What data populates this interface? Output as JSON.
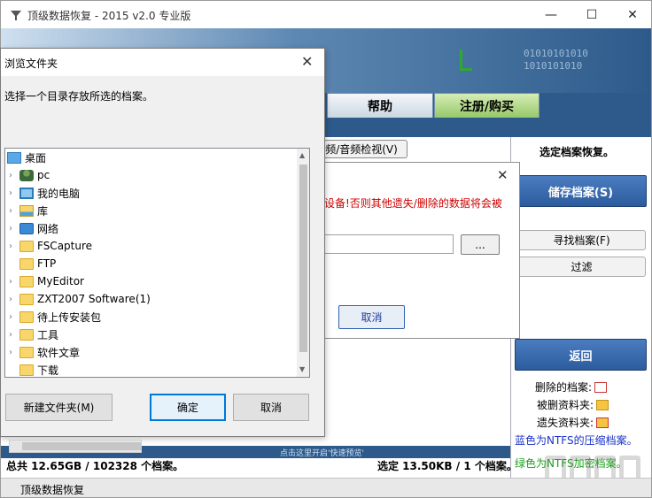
{
  "main_window": {
    "title": "顶级数据恢复 - 2015 v2.0 专业版",
    "controls": {
      "minimize": "—",
      "maximize": "☐",
      "close": "✕"
    }
  },
  "header": {
    "binary_text": "01010101010\n1010101010"
  },
  "tabs": [
    {
      "label": "帮助"
    },
    {
      "label": "注册/购买"
    }
  ],
  "preview_button": "频/音频检视(V)",
  "right_panel": {
    "title": "选定档案恢复。",
    "save_button": "储存档案(S)",
    "find_button": "寻找档案(F)",
    "filter_button": "过滤",
    "return_button": "返回",
    "legend": {
      "deleted": "删除的档案:",
      "deleted_folder": "被删资料夹:",
      "lost_folder": "遗失资料夹:",
      "blue_note": "蓝色为NTFS的压缩档案。",
      "green_note": "绿色为NTFS加密档案。"
    }
  },
  "mid_dialog": {
    "warning": "设备!否则其他遗失/删除的数据将会被",
    "browse_label": "...",
    "cancel_label": "取消"
  },
  "quickview_bar": "点击这里开启'快速预览'",
  "totals": {
    "left": "总共 12.65GB / 102328 个档案。",
    "right": "选定 13.50KB / 1 个档案。"
  },
  "taskbar": {
    "item": "顶级数据恢复"
  },
  "browse_dialog": {
    "title": "浏览文件夹",
    "description": "选择一个目录存放所选的档案。",
    "tree": [
      {
        "label": "桌面",
        "icon": "desktop-icon",
        "chevron": ""
      },
      {
        "label": "pc",
        "icon": "user-icon",
        "chevron": "›"
      },
      {
        "label": "我的电脑",
        "icon": "computer-icon",
        "chevron": "›"
      },
      {
        "label": "库",
        "icon": "library-icon",
        "chevron": "›"
      },
      {
        "label": "网络",
        "icon": "network-icon",
        "chevron": "›"
      },
      {
        "label": "FSCapture",
        "icon": "folder-icon",
        "chevron": "›"
      },
      {
        "label": "FTP",
        "icon": "folder-icon",
        "chevron": ""
      },
      {
        "label": "MyEditor",
        "icon": "folder-icon",
        "chevron": "›"
      },
      {
        "label": "ZXT2007 Software(1)",
        "icon": "folder-icon",
        "chevron": "›"
      },
      {
        "label": "待上传安装包",
        "icon": "folder-icon",
        "chevron": "›"
      },
      {
        "label": "工具",
        "icon": "folder-icon",
        "chevron": "›"
      },
      {
        "label": "软件文章",
        "icon": "folder-icon",
        "chevron": "›"
      },
      {
        "label": "下载",
        "icon": "folder-icon",
        "chevron": ""
      }
    ],
    "new_folder_button": "新建文件夹(M)",
    "ok_button": "确定",
    "cancel_button": "取消"
  }
}
